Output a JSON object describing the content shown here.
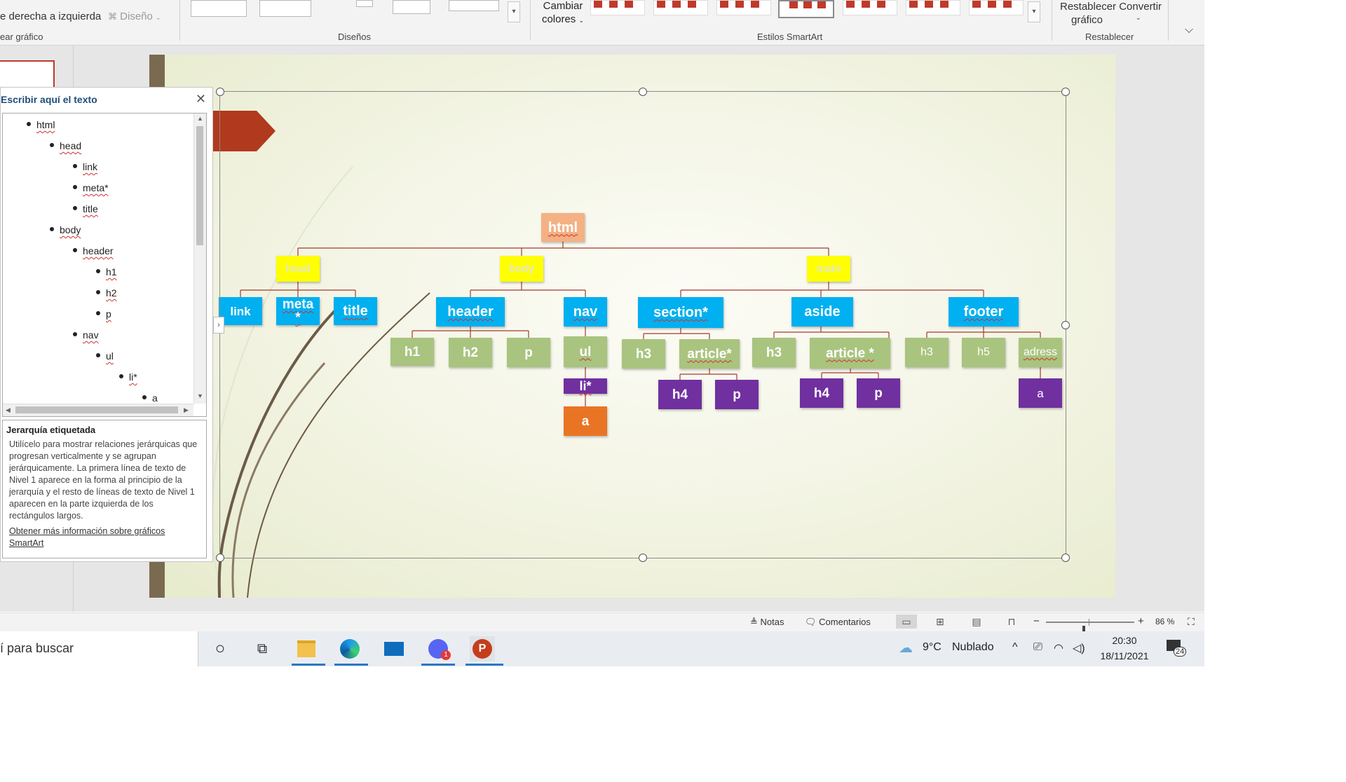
{
  "ribbon": {
    "frag_top_left": "e derecha a izquierda",
    "frag_diseno": "Diseño",
    "frag_crear": "ear gráfico",
    "group_disenos": "Diseños",
    "cambiar_colores_line1": "Cambiar",
    "cambiar_colores_line2": "colores",
    "group_estilos": "Estilos SmartArt",
    "restablecer_convertir": "Restablecer Convertir",
    "grafico": "gráfico",
    "group_restablecer": "Restablecer"
  },
  "text_pane": {
    "title": "Escribir aquí el texto",
    "items": [
      {
        "text": "html",
        "level": 0
      },
      {
        "text": "head",
        "level": 1
      },
      {
        "text": "link",
        "level": 2
      },
      {
        "text": "meta*",
        "level": 2
      },
      {
        "text": "title",
        "level": 2
      },
      {
        "text": "body",
        "level": 1
      },
      {
        "text": "header",
        "level": 2
      },
      {
        "text": "h1",
        "level": 3
      },
      {
        "text": "h2",
        "level": 3
      },
      {
        "text": "p",
        "level": 3
      },
      {
        "text": "nav",
        "level": 2
      },
      {
        "text": "ul",
        "level": 3
      },
      {
        "text": "li*",
        "level": 4
      },
      {
        "text": "a",
        "level": 5
      }
    ],
    "description_title": "Jerarquía etiquetada",
    "description_body": "Utilícelo para mostrar relaciones jerárquicas que progresan verticalmente y se agrupan jerárquicamente. La primera línea de texto de Nivel 1 aparece en la forma al principio de la jerarquía y el resto de líneas de texto de Nivel 1 aparecen en la parte izquierda de los rectángulos largos.",
    "description_link": "Obtener más información sobre gráficos SmartArt"
  },
  "smartart": {
    "nodes": {
      "html": "html",
      "head": "head",
      "body": "body",
      "main": "main",
      "link": "link",
      "meta": "meta *",
      "title": "title",
      "header": "header",
      "nav": "nav",
      "section": "section*",
      "aside": "aside",
      "footer": "footer",
      "h1": "h1",
      "h2": "h2",
      "p_header": "p",
      "ul": "ul",
      "h3_section": "h3",
      "article_section": "article*",
      "h3_aside": "h3",
      "article_aside": "article *",
      "h3_footer": "h3",
      "h5_footer": "h5",
      "adress": "adress",
      "li": "li*",
      "h4_section": "h4",
      "p_section": "p",
      "h4_aside": "h4",
      "p_aside": "p",
      "a_footer": "a",
      "a_nav": "a"
    },
    "colors": {
      "level0": "#f4b183",
      "level1": "#ffff00",
      "level2": "#00b0f0",
      "level3": "#a9c47f",
      "level4": "#7030a0",
      "level5": "#e97524",
      "connector": "#a33a2a"
    }
  },
  "status_bar": {
    "notas": "Notas",
    "comentarios": "Comentarios",
    "zoom_minus": "−",
    "zoom_plus": "+",
    "zoom_percent": "86 %",
    "zoom_level": 0.86
  },
  "taskbar": {
    "search_text": "í para buscar",
    "temperature": "9°C",
    "weather": "Nublado",
    "time": "20:30",
    "date": "18/11/2021",
    "notification_count": "24",
    "mail_badge": "1"
  }
}
